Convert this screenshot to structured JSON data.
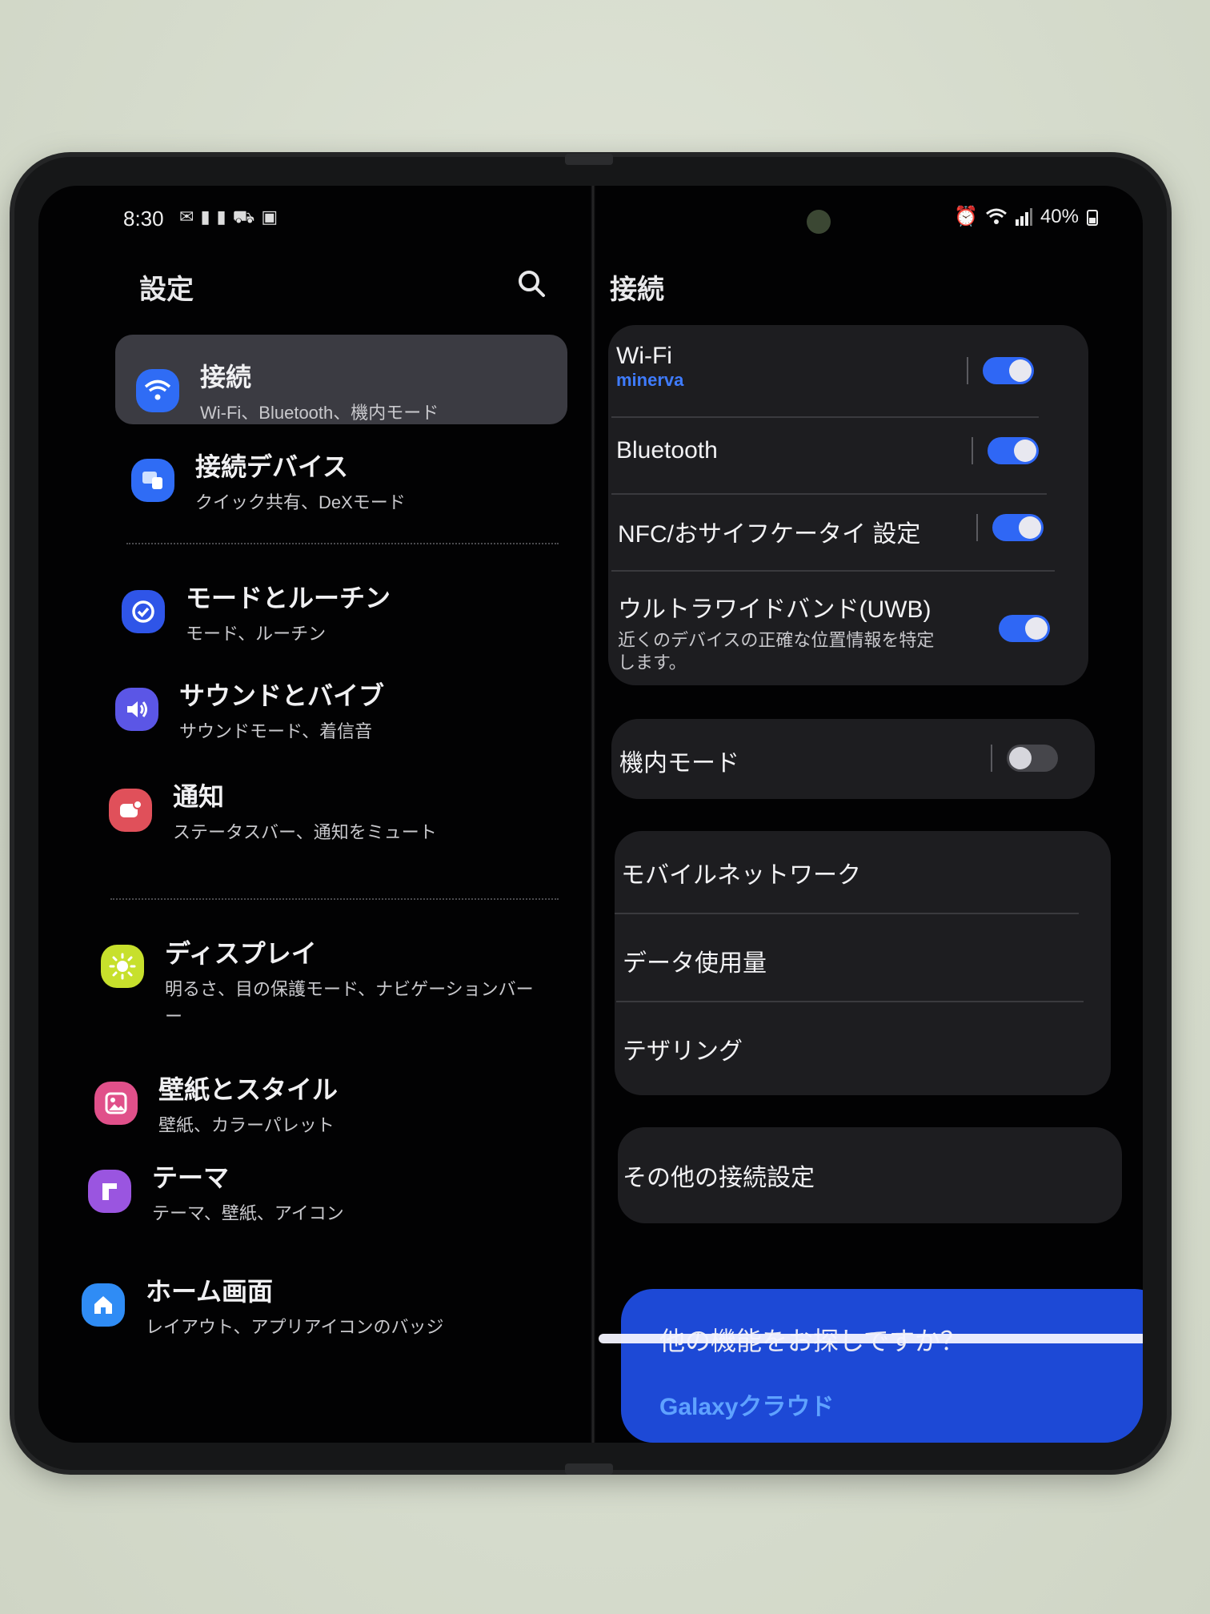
{
  "status_bar": {
    "time": "8:30",
    "left_icons": [
      "mail-icon",
      "alert-icon",
      "alert-icon",
      "car-icon",
      "cast-icon"
    ],
    "battery": "40%",
    "right_icons": [
      "alarm-icon",
      "wifi-icon",
      "signal-icon",
      "battery-icon"
    ]
  },
  "left_panel": {
    "title": "設定",
    "items": [
      {
        "title": "接続",
        "subtitle": "Wi-Fi、Bluetooth、機内モード",
        "icon": "wifi-icon",
        "color": "#2f6cf5"
      },
      {
        "title": "接続デバイス",
        "subtitle": "クイック共有、DeXモード",
        "icon": "devices-icon",
        "color": "#2f6cf5"
      },
      {
        "title": "モードとルーチン",
        "subtitle": "モード、ルーチン",
        "icon": "check-circle-icon",
        "color": "#2f55e8"
      },
      {
        "title": "サウンドとバイブ",
        "subtitle": "サウンドモード、着信音",
        "icon": "volume-icon",
        "color": "#5b56e6"
      },
      {
        "title": "通知",
        "subtitle": "ステータスバー、通知をミュート",
        "icon": "notification-icon",
        "color": "#e0505a"
      },
      {
        "title": "ディスプレイ",
        "subtitle": "明るさ、目の保護モード、ナビゲーションバー",
        "subtitle_tail": "ー",
        "icon": "sun-icon",
        "color": "#c7e02c"
      },
      {
        "title": "壁紙とスタイル",
        "subtitle": "壁紙、カラーパレット",
        "icon": "image-icon",
        "color": "#e0508a"
      },
      {
        "title": "テーマ",
        "subtitle": "テーマ、壁紙、アイコン",
        "icon": "theme-icon",
        "color": "#9a55e0"
      },
      {
        "title": "ホーム画面",
        "subtitle": "レイアウト、アプリアイコンのバッジ",
        "icon": "home-icon",
        "color": "#2f8cf5"
      }
    ]
  },
  "right_panel": {
    "title": "接続",
    "wifi": {
      "label": "Wi-Fi",
      "network": "minerva",
      "enabled": true
    },
    "bluetooth": {
      "label": "Bluetooth",
      "enabled": true
    },
    "nfc": {
      "label": "NFC/おサイフケータイ 設定",
      "enabled": true
    },
    "uwb": {
      "label": "ウルトラワイドバンド(UWB)",
      "desc_line1": "近くのデバイスの正確な位置情報を特定",
      "desc_line2": "します。",
      "enabled": true
    },
    "airplane": {
      "label": "機内モード",
      "enabled": false
    },
    "mobile_network": "モバイルネットワーク",
    "data_usage": "データ使用量",
    "tethering": "テザリング",
    "other_settings": "その他の接続設定",
    "promo": {
      "text": "他の機能をお探しですか？",
      "link": "Galaxyクラウド"
    }
  },
  "colors": {
    "accent": "#2f67f5",
    "link": "#3f7cff",
    "card": "#1d1d20",
    "screen": "#020203"
  }
}
